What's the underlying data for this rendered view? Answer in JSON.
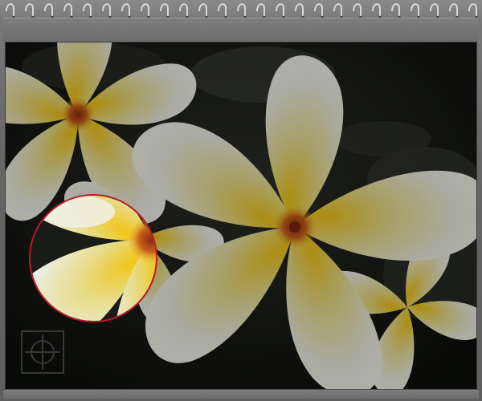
{
  "window": {
    "view": "calendar-page-photo-preview"
  },
  "binding": {
    "ring_count": 25,
    "ring_color": "#d8d8d8"
  },
  "photo": {
    "subject": "plumeria-flowers",
    "background_color": "#0f110e",
    "petal_color": "#e9ead6",
    "center_color": "#e2c21a",
    "throat_color": "#b0481a"
  },
  "magnifier": {
    "icon": "magnifier-lens-icon",
    "border_color": "#c0182a",
    "zoom_level": 2
  },
  "logo": {
    "icon": "watermark-logo-icon"
  }
}
